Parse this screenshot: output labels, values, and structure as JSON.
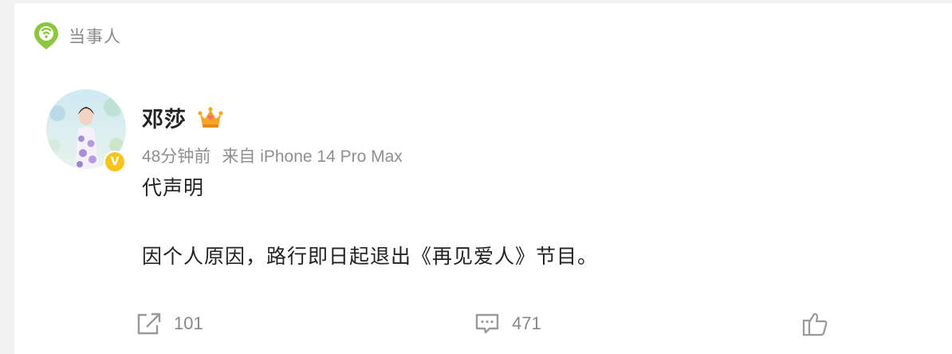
{
  "card": {
    "source_label": "当事人"
  },
  "post": {
    "user_name": "邓莎",
    "verified_mark": "V",
    "time": "48分钟前",
    "via": "来自 iPhone 14 Pro Max",
    "line1": "代声明",
    "line2": "因个人原因，路行即日起退出《再见爱人》节目。"
  },
  "actions": {
    "repost_count": "101",
    "comment_count": "471"
  },
  "colors": {
    "source_icon": "#8cc63f",
    "verified": "#f7c31c",
    "crown": "#f6a623"
  },
  "icons": {
    "source": "location-pin-icon",
    "crown": "crown-icon",
    "repost": "repost-icon",
    "comment": "comment-icon",
    "like": "like-icon"
  }
}
